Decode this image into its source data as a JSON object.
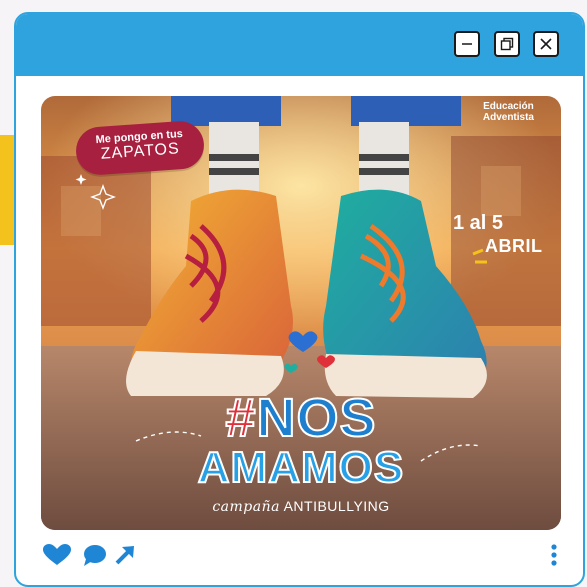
{
  "colors": {
    "titlebar": "#2ea3dd",
    "border": "#2ea3dd",
    "accent_strip": "#f4c21c",
    "action_icons": "#1f86d6"
  },
  "window_controls": {
    "minimize_icon": "minimize-icon",
    "restore_icon": "restore-icon",
    "close_icon": "close-icon"
  },
  "poster": {
    "tag_line1": "Me pongo en tus",
    "tag_line2": "ZAPATOS",
    "brand_line1": "Educación",
    "brand_line2": "Adventista",
    "date_line1": "1 al 5",
    "date_line2": "ABRIL",
    "headline_hash": "#",
    "headline_word1": "NOS",
    "headline_word2": "AMAMOS",
    "sub_script": "campaña",
    "sub_caps": "ANTIBULLYING"
  },
  "actions": {
    "like_icon": "heart-icon",
    "comment_icon": "comment-icon",
    "share_icon": "share-arrow-icon",
    "more_icon": "more-vertical-icon"
  }
}
